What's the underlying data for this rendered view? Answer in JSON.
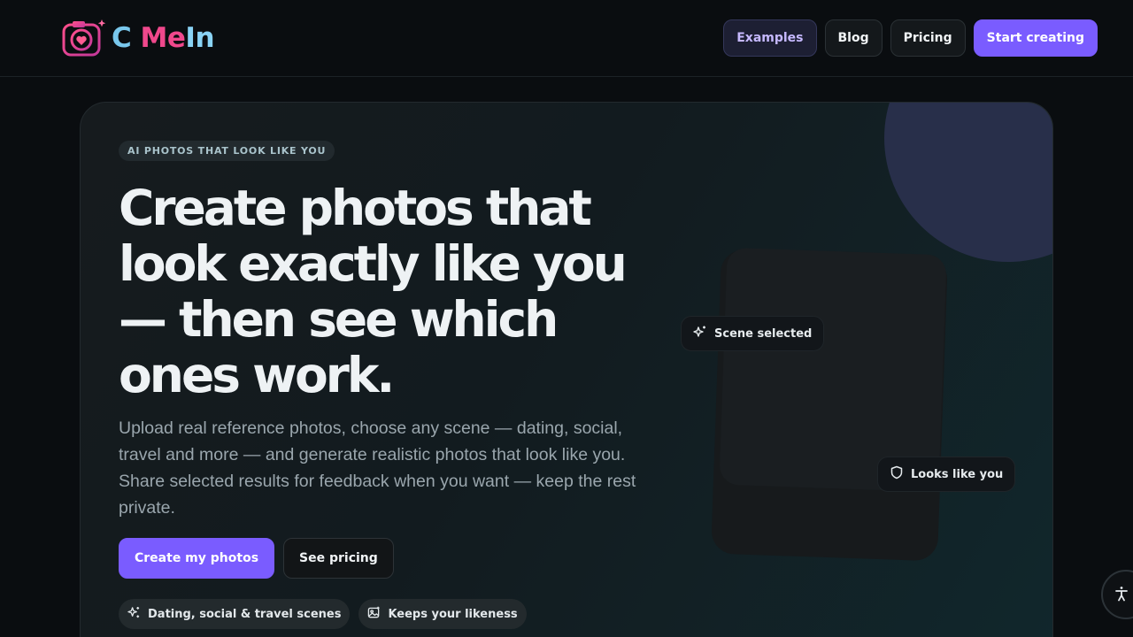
{
  "brand": {
    "name_c": "C ",
    "name_me": "Me",
    "name_in": "In",
    "accent": "#7a5cff"
  },
  "nav": {
    "items": [
      {
        "label": "Examples",
        "state": "active"
      },
      {
        "label": "Blog"
      },
      {
        "label": "Pricing"
      },
      {
        "label": "Start creating",
        "style": "primary"
      }
    ]
  },
  "hero": {
    "eyebrow": "AI PHOTOS THAT LOOK LIKE YOU",
    "headline": "Create photos that look exactly like you — then see which ones work.",
    "subtext": "Upload real reference photos, choose any scene — dating, social, travel and more — and generate realistic photos that look like you. Share selected results for feedback when you want — keep the rest private.",
    "cta_primary": "Create my photos",
    "cta_secondary": "See pricing",
    "chips": [
      {
        "label": "Dating, social & travel scenes",
        "icon": "sparkles-icon"
      },
      {
        "label": "Keeps your likeness",
        "icon": "image-icon"
      }
    ],
    "badges": {
      "scene": "Scene selected",
      "likeness": "Looks like you"
    }
  },
  "icons": {
    "badge_scene": "sparkles-icon",
    "badge_likeness": "shield-icon",
    "accessibility": "accessibility-icon"
  }
}
